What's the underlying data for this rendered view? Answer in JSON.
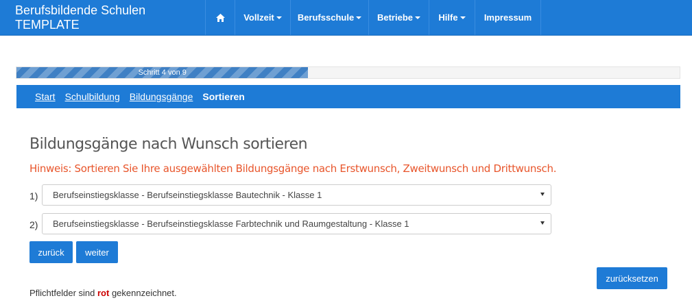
{
  "navbar": {
    "brand": "Berufsbildende Schulen TEMPLATE",
    "home_icon": "home-icon",
    "items": [
      {
        "label": "Vollzeit",
        "dropdown": true
      },
      {
        "label": "Berufsschule",
        "dropdown": true
      },
      {
        "label": "Betriebe",
        "dropdown": true
      },
      {
        "label": "Hilfe",
        "dropdown": true
      },
      {
        "label": "Impressum",
        "dropdown": false
      }
    ]
  },
  "progress": {
    "label": "Schritt 4 von 9",
    "value_fraction": 0.44
  },
  "breadcrumb": {
    "items": [
      {
        "label": "Start",
        "active": false
      },
      {
        "label": "Schulbildung",
        "active": false
      },
      {
        "label": "Bildungsgänge",
        "active": false
      },
      {
        "label": "Sortieren",
        "active": true
      }
    ]
  },
  "main": {
    "title": "Bildungsgänge nach Wunsch sortieren",
    "hint": "Hinweis: Sortieren Sie Ihre ausgewählten Bildungsgänge nach Erstwunsch, Zweitwunsch und Drittwunsch.",
    "selects": [
      {
        "label": "1)",
        "value": "Berufseinstiegsklasse - Berufseinstiegsklasse Bautechnik - Klasse 1"
      },
      {
        "label": "2)",
        "value": "Berufseinstiegsklasse - Berufseinstiegsklasse Farbtechnik und Raumgestaltung - Klasse 1"
      }
    ],
    "back_button": "zurück",
    "next_button": "weiter",
    "reset_button": "zurücksetzen"
  },
  "footer": {
    "note_prefix": "Pflichtfelder sind ",
    "note_red": "rot",
    "note_suffix": " gekennzeichnet."
  },
  "colors": {
    "primary": "#1e7bd6",
    "hint": "#e8552b",
    "required": "#cc0000"
  }
}
